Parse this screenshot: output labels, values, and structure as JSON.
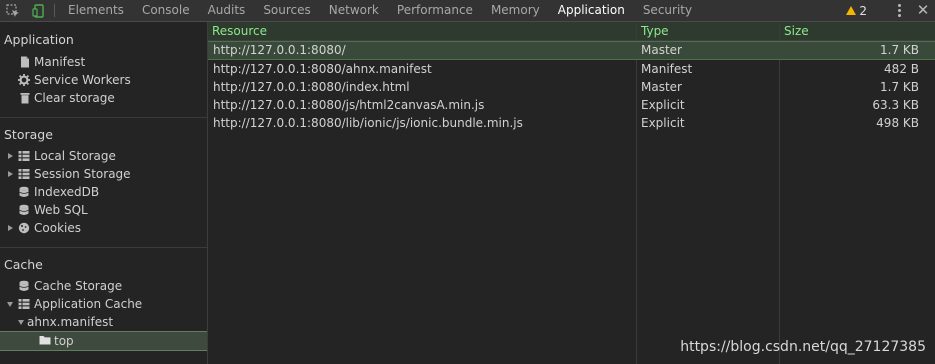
{
  "toolbar": {
    "tabs": [
      "Elements",
      "Console",
      "Audits",
      "Sources",
      "Network",
      "Performance",
      "Memory",
      "Application",
      "Security"
    ],
    "active_tab": "Application",
    "warning_count": "2"
  },
  "sidebar": {
    "application": {
      "title": "Application",
      "items": [
        {
          "label": "Manifest",
          "icon": "document-icon"
        },
        {
          "label": "Service Workers",
          "icon": "gear-icon"
        },
        {
          "label": "Clear storage",
          "icon": "trash-icon"
        }
      ]
    },
    "storage": {
      "title": "Storage",
      "items": [
        {
          "label": "Local Storage",
          "icon": "grid-icon",
          "expandable": true
        },
        {
          "label": "Session Storage",
          "icon": "grid-icon",
          "expandable": true
        },
        {
          "label": "IndexedDB",
          "icon": "database-icon"
        },
        {
          "label": "Web SQL",
          "icon": "database-icon"
        },
        {
          "label": "Cookies",
          "icon": "cookie-icon",
          "expandable": true
        }
      ]
    },
    "cache": {
      "title": "Cache",
      "items": [
        {
          "label": "Cache Storage",
          "icon": "database-icon"
        },
        {
          "label": "Application Cache",
          "icon": "grid-icon",
          "expanded": true
        },
        {
          "label": "ahnx.manifest",
          "expanded": true
        },
        {
          "label": "top",
          "icon": "folder-icon",
          "selected": true
        }
      ]
    }
  },
  "table": {
    "headers": {
      "resource": "Resource",
      "type": "Type",
      "size": "Size"
    },
    "rows": [
      {
        "resource": "http://127.0.0.1:8080/",
        "type": "Master",
        "size": "1.7 KB"
      },
      {
        "resource": "http://127.0.0.1:8080/ahnx.manifest",
        "type": "Manifest",
        "size": "482 B"
      },
      {
        "resource": "http://127.0.0.1:8080/index.html",
        "type": "Master",
        "size": "1.7 KB"
      },
      {
        "resource": "http://127.0.0.1:8080/js/html2canvasA.min.js",
        "type": "Explicit",
        "size": "63.3 KB"
      },
      {
        "resource": "http://127.0.0.1:8080/lib/ionic/js/ionic.bundle.min.js",
        "type": "Explicit",
        "size": "498 KB"
      }
    ]
  },
  "watermark": "https://blog.csdn.net/qq_27127385"
}
